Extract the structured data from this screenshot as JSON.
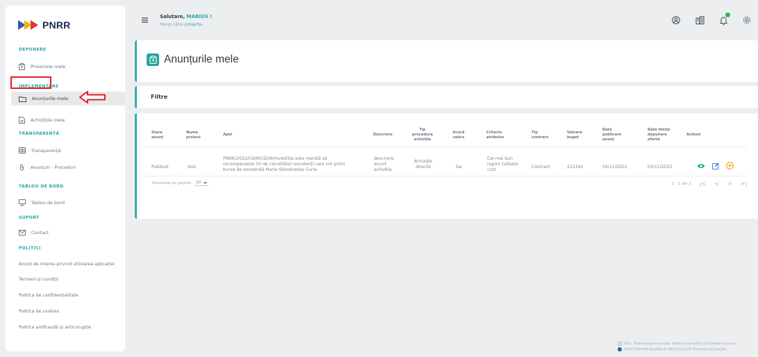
{
  "logo": {
    "text": "PNRR"
  },
  "sidebar": {
    "sec_depunere": "DEPUNERE",
    "proiecte": "Proiectele mele",
    "sec_implementare": "IMPLEMENTARE",
    "anunturi": "Anunțurile mele",
    "achizitii": "Achizițiile mele",
    "sec_transparenta": "TRANSPARENȚĂ",
    "transparenta": "Transparență",
    "anunturi_proceduri": "Anunțuri - Proceduri",
    "sec_tablou": "TABLOU DE BORD",
    "tablou": "Tablou de bord",
    "sec_suport": "SUPORT",
    "contact": "Contact",
    "sec_politici": "POLITICI",
    "p1": "Anunț de interes privind utilizarea aplicației",
    "p2": "Termeni și condiții",
    "p3": "Politica de confidențialitate",
    "p4": "Politica de cookies",
    "p5": "Politica antifraudă și anticorupție"
  },
  "header": {
    "greeting": "Salutare,",
    "user": "MARIUS !",
    "goto_prefix": "Mergi către",
    "goto_link": "proiecte."
  },
  "page": {
    "title": "Anunțurile mele"
  },
  "filters": {
    "title": "Filtre"
  },
  "table": {
    "headers": {
      "stare": [
        "Stare",
        "anunț"
      ],
      "nume": [
        "Nume",
        "proiect"
      ],
      "apel": [
        "Apel"
      ],
      "descriere": [
        "Descriere"
      ],
      "tip_procedura": [
        "Tip",
        "procedură",
        "achiziție"
      ],
      "acord": [
        "Acord",
        "cadru"
      ],
      "criteriu": [
        "Criteriu",
        "atribuire"
      ],
      "tip_contract": [
        "Tip",
        "contract"
      ],
      "valoare": [
        "Valoare",
        "buget"
      ],
      "data_publicare": [
        "Dată",
        "publicare",
        "anunț"
      ],
      "data_limita": [
        "Dată limită",
        "depunere",
        "ofertă"
      ],
      "actiuni": [
        "Acțiuni"
      ]
    },
    "row": {
      "stare": "Publicat",
      "nume": "test",
      "apel": [
        "PNRR/2022/C9/MCID/I9/Investiția este menită să",
        "recompenseze 50 de cercetători excelenți care vor primi",
        "burse de excelență Marie Sklodowska Curie"
      ],
      "descriere": [
        "descriere",
        "anunt",
        "achizitie"
      ],
      "tip_procedura": [
        "Achiziție",
        "directă"
      ],
      "acord": "Da",
      "criteriu": [
        "Cel mai bun",
        "raport calitate-",
        "cost"
      ],
      "tip_contract": "Contract",
      "valoare": "212342",
      "data_publicare": "04/11/2022",
      "data_limita": "03/11/2022"
    },
    "pager": {
      "per_page_label": "Elemente pe pagină:",
      "per_page": "10",
      "range": "1 - 1 din 1"
    }
  },
  "footer": {
    "line1": "2022 - Toate drepturile rezervate - Ministerul Investițiilor și Proiectelor Europene",
    "line2": "Sistem informatic dezvoltat de către Serviciul de Telecomunicații Speciale"
  },
  "colors": {
    "accent": "#24a8a3",
    "annotation": "#e81c24"
  }
}
